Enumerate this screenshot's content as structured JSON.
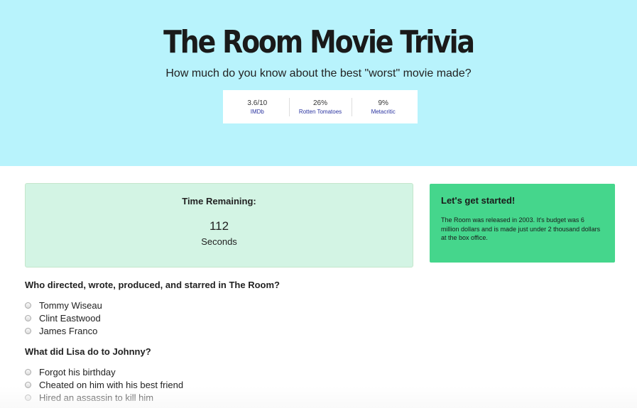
{
  "header": {
    "title": "The Room Movie Trivia",
    "subtitle": "How much do you know about the best \"worst\" movie made?",
    "ratings": [
      {
        "score": "3.6/10",
        "source": "IMDb"
      },
      {
        "score": "26%",
        "source": "Rotten Tomatoes"
      },
      {
        "score": "9%",
        "source": "Metacritic"
      }
    ]
  },
  "timer": {
    "label": "Time Remaining:",
    "value": "112",
    "unit": "Seconds"
  },
  "info": {
    "title": "Let's get started!",
    "text": "The Room was released in 2003. It's budget was 6 million dollars and is made just under 2 thousand dollars at the box office."
  },
  "questions": [
    {
      "text": "Who directed, wrote, produced, and starred in The Room?",
      "options": [
        "Tommy Wiseau",
        "Clint Eastwood",
        "James Franco"
      ]
    },
    {
      "text": "What did Lisa do to Johnny?",
      "options": [
        "Forgot his birthday",
        "Cheated on him with his best friend",
        "Hired an assassin to kill him"
      ]
    }
  ],
  "colors": {
    "hero_bg": "#b8f3fc",
    "timer_bg": "#d3f4e4",
    "info_bg": "#45d68c",
    "rating_link": "#2a33a0"
  }
}
